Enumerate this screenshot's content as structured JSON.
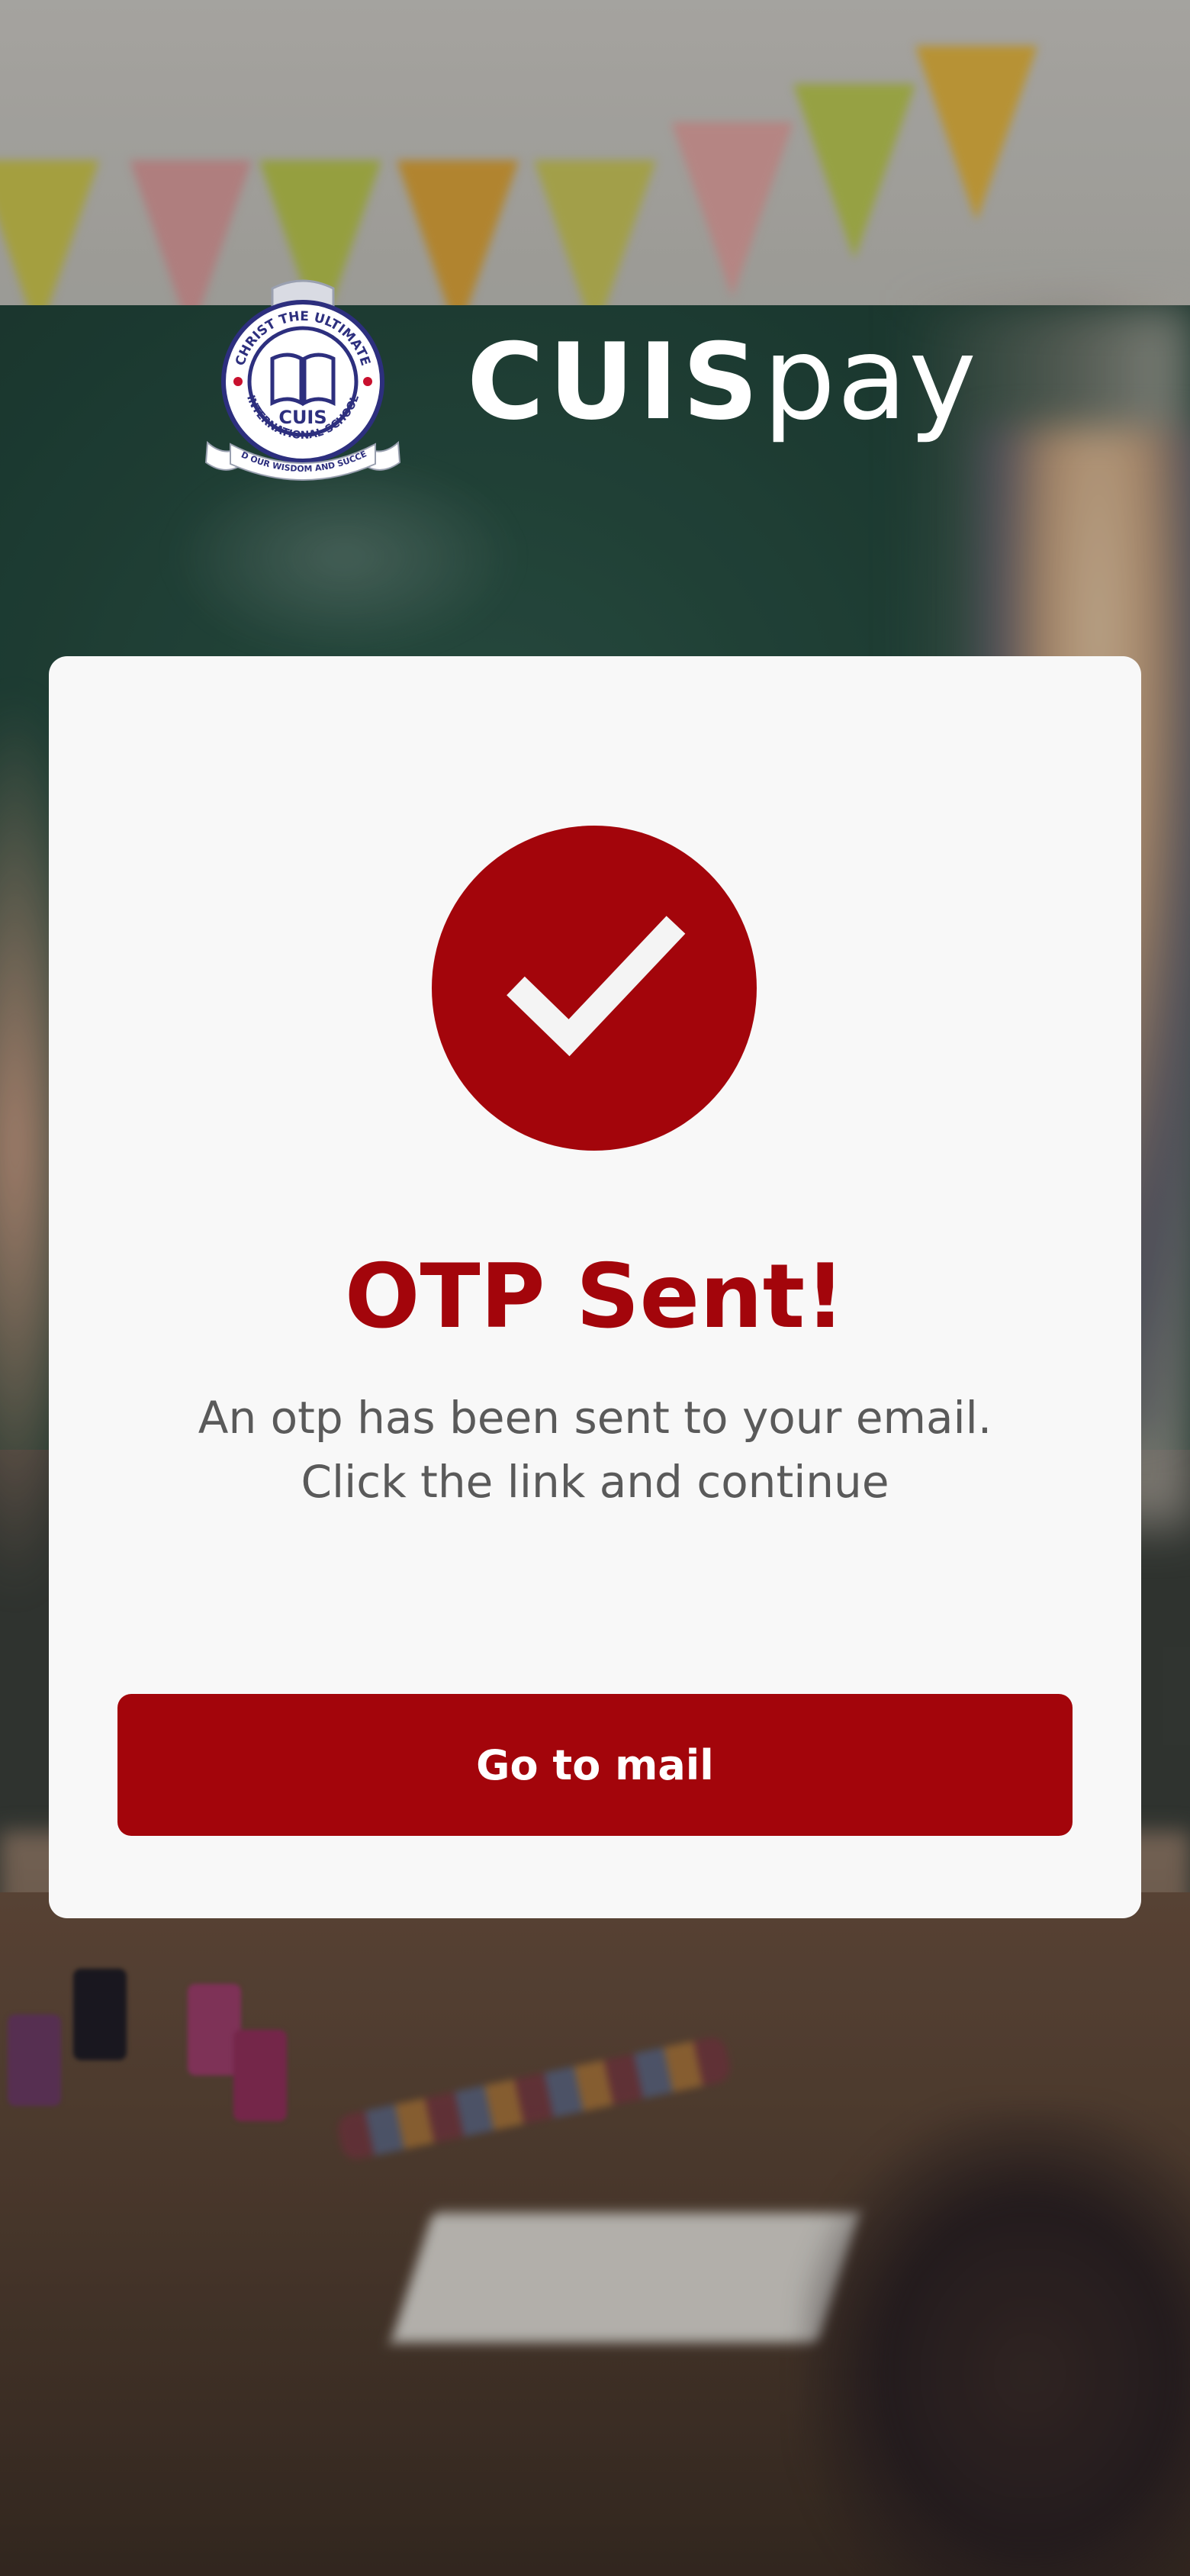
{
  "brand": {
    "crest": {
      "top_text": "CHRIST THE ULTIMATE",
      "center_text": "CUIS",
      "bottom_text": "INTERNATIONAL SCHOOL",
      "motto": "GOD OUR WISDOM AND SUCCESS"
    },
    "wordmark_bold": "CUIS",
    "wordmark_light": "pay"
  },
  "card": {
    "icon": "check-icon",
    "title": "OTP Sent!",
    "message_line1": "An otp has been sent to your email.",
    "message_line2": "Click the link and continue",
    "button_label": "Go to mail"
  },
  "colors": {
    "accent": "#a3050b",
    "card_bg": "#f8f8f8",
    "text_secondary": "#5a5a5a"
  }
}
